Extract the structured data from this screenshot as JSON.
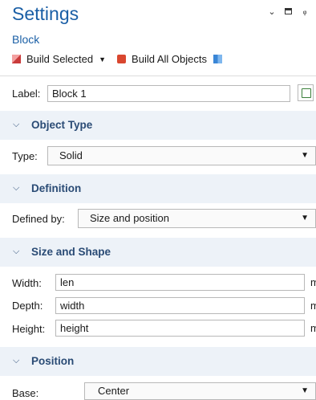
{
  "header": {
    "title": "Settings",
    "subtitle": "Block"
  },
  "toolbar": {
    "build_selected": "Build Selected",
    "build_all": "Build All Objects"
  },
  "label_field": {
    "label": "Label:",
    "value": "Block 1"
  },
  "sections": {
    "object_type": {
      "title": "Object Type",
      "type_label": "Type:",
      "type_value": "Solid"
    },
    "definition": {
      "title": "Definition",
      "defined_by_label": "Defined by:",
      "defined_by_value": "Size and position"
    },
    "size_shape": {
      "title": "Size and Shape",
      "width_label": "Width:",
      "width_value": "len",
      "depth_label": "Depth:",
      "depth_value": "width",
      "height_label": "Height:",
      "height_value": "height",
      "unit": "m"
    },
    "position": {
      "title": "Position",
      "base_label": "Base:",
      "base_value": "Center"
    }
  },
  "colors": {
    "accent": "#1a5fa6",
    "section_bg": "#edf2f8",
    "section_text": "#2a4b75"
  }
}
